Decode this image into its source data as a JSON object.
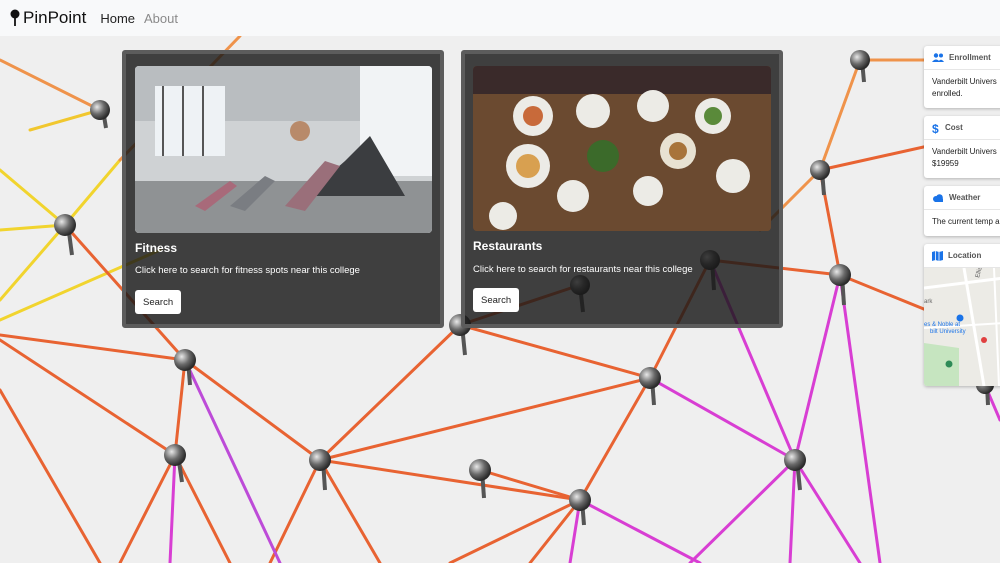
{
  "nav": {
    "brand": "PinPoint",
    "links": [
      "Home",
      "About"
    ]
  },
  "cards": [
    {
      "title": "Fitness",
      "text": "Click here to search for fitness spots near this college",
      "button": "Search",
      "image": "fitness-class-photo"
    },
    {
      "title": "Restaurants",
      "text": "Click here to search for restaurants near this college",
      "button": "Search",
      "image": "restaurant-table-photo"
    }
  ],
  "side": {
    "enrollment": {
      "title": "Enrollment",
      "text": "Vanderbilt Univers\nenrolled.",
      "icon": "people-icon",
      "color": "#1a73e8"
    },
    "cost": {
      "title": "Cost",
      "text": "Vanderbilt Univers\n$19959",
      "icon": "dollar-icon",
      "color": "#1a73e8"
    },
    "weather": {
      "title": "Weather",
      "text": "The current temp a",
      "icon": "cloud-icon",
      "color": "#1a73e8"
    },
    "location": {
      "title": "Location",
      "icon": "map-icon",
      "color": "#1a73e8",
      "map_labels": [
        "Ellisto",
        "ark",
        "es & Noble at",
        "bilt University"
      ]
    }
  },
  "colors": {
    "string_orange": "#e8541e",
    "string_magenta": "#d62bd0",
    "string_yellow": "#f2d21a",
    "pin": "#5a5a5a"
  }
}
